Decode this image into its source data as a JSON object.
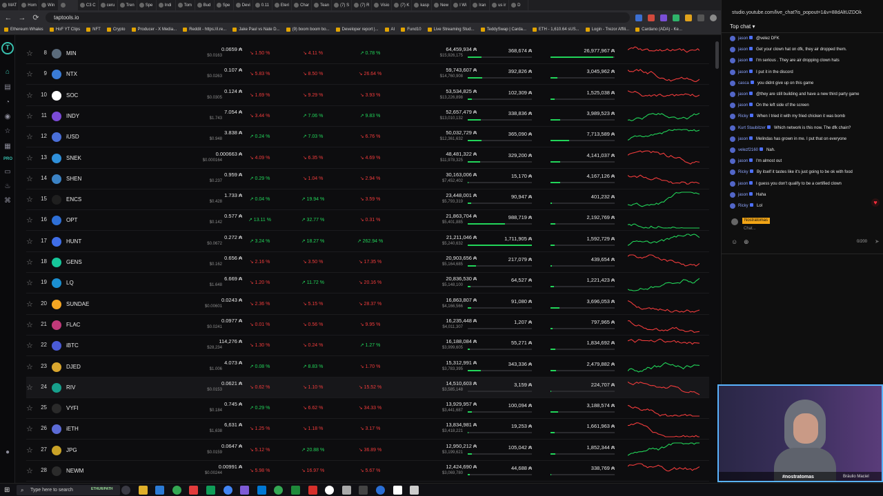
{
  "browser": {
    "tabs": [
      "MAT",
      "Hom",
      "Win",
      "",
      "C3 C",
      "ceru",
      "Tren",
      "Spe",
      "Indi",
      "Tom",
      "Bud",
      "Spe",
      "Devi",
      "0.11",
      "Eteri",
      "Char",
      "Tean",
      "(7) S",
      "(7) R",
      "Visio",
      "(7) K",
      "kasp",
      "New",
      "I Wi",
      "Iran",
      "us ir",
      "D"
    ],
    "url": "taptools.io",
    "bookmarks": [
      "Ethereum Whales",
      "HoF YT Clips",
      "NFT",
      "Crypto",
      "Producer - X Media...",
      "Reddit - https://i.re...",
      "Jake Paul vs Nate D...",
      "(9) boom boom bo...",
      "Developer report |...",
      "AI",
      "Fund10",
      "Live Streaming Stud...",
      "TeddySwap | Carda...",
      "ETH - 1,610.64 sUS...",
      "Login - Trezor Affili...",
      "Cardano (ADA) - Ke..."
    ]
  },
  "sidebar": {
    "logo": "T",
    "pro_label": "PRO"
  },
  "colors": {
    "negative": "#f23c3c",
    "positive": "#22d65a",
    "accent": "#39c2b0"
  },
  "tokens": [
    {
      "rank": "8",
      "name": "MIN",
      "price": "0.0659 ₳",
      "usd": "$0.0163",
      "c1": "↘ 1.50 %",
      "c1d": "neg",
      "c2": "↘ 4.11 %",
      "c2d": "neg",
      "c3": "↗ 0.78 %",
      "c3d": "pos",
      "mcap": "64,459,934 ₳",
      "mcapusd": "$15,926,175",
      "vol": "368,674 ₳",
      "volpct": 0.22,
      "liq": "26,977,967 ₳",
      "liqpct": 0.98,
      "spark": "neg",
      "icon": "#5a6a7a",
      "hl": false
    },
    {
      "rank": "9",
      "name": "NTX",
      "price": "0.107 ₳",
      "usd": "$0.0263",
      "c1": "↘ 5.83 %",
      "c1d": "neg",
      "c2": "↘ 8.50 %",
      "c2d": "neg",
      "c3": "↘ 26.64 %",
      "c3d": "neg",
      "mcap": "59,743,607 ₳",
      "mcapusd": "$14,760,908",
      "vol": "392,826 ₳",
      "volpct": 0.23,
      "liq": "3,045,962 ₳",
      "liqpct": 0.11,
      "spark": "neg",
      "icon": "#3a7bd5",
      "hl": false
    },
    {
      "rank": "10",
      "name": "SOC",
      "price": "0.124 ₳",
      "usd": "$0.0305",
      "c1": "↘ 1.69 %",
      "c1d": "neg",
      "c2": "↘ 9.29 %",
      "c2d": "neg",
      "c3": "↘ 3.93 %",
      "c3d": "neg",
      "mcap": "53,534,825 ₳",
      "mcapusd": "$13,226,898",
      "vol": "102,309 ₳",
      "volpct": 0.06,
      "liq": "1,525,038 ₳",
      "liqpct": 0.06,
      "spark": "neg",
      "icon": "#ffffff",
      "hl": false
    },
    {
      "rank": "11",
      "name": "INDY",
      "price": "7.054 ₳",
      "usd": "$1.743",
      "c1": "↘ 3.44 %",
      "c1d": "neg",
      "c2": "↗ 7.06 %",
      "c2d": "pos",
      "c3": "↗ 9.83 %",
      "c3d": "pos",
      "mcap": "52,657,479 ₳",
      "mcapusd": "$13,010,132",
      "vol": "338,836 ₳",
      "volpct": 0.2,
      "liq": "3,989,523 ₳",
      "liqpct": 0.15,
      "spark": "pos",
      "icon": "#7b4bd6",
      "hl": false
    },
    {
      "rank": "12",
      "name": "iUSD",
      "price": "3.838 ₳",
      "usd": "$0.948",
      "c1": "↗ 0.24 %",
      "c1d": "pos",
      "c2": "↗ 7.03 %",
      "c2d": "pos",
      "c3": "↘ 6.76 %",
      "c3d": "neg",
      "mcap": "50,032,729 ₳",
      "mcapusd": "$12,361,632",
      "vol": "365,090 ₳",
      "volpct": 0.21,
      "liq": "7,713,589 ₳",
      "liqpct": 0.29,
      "spark": "pos",
      "icon": "#4a6fd8",
      "hl": false
    },
    {
      "rank": "13",
      "name": "SNEK",
      "price": "0.000663 ₳",
      "usd": "$0.000164",
      "c1": "↘ 4.09 %",
      "c1d": "neg",
      "c2": "↘ 6.35 %",
      "c2d": "neg",
      "c3": "↘ 4.69 %",
      "c3d": "neg",
      "mcap": "48,481,322 ₳",
      "mcapusd": "$11,978,325",
      "vol": "329,200 ₳",
      "volpct": 0.19,
      "liq": "4,141,037 ₳",
      "liqpct": 0.15,
      "spark": "neg",
      "icon": "#2f8fd9",
      "hl": false
    },
    {
      "rank": "14",
      "name": "SHEN",
      "price": "0.959 ₳",
      "usd": "$0.237",
      "c1": "↗ 0.29 %",
      "c1d": "pos",
      "c2": "↘ 1.04 %",
      "c2d": "neg",
      "c3": "↘ 2.94 %",
      "c3d": "neg",
      "mcap": "30,163,006 ₳",
      "mcapusd": "$7,452,402",
      "vol": "15,170 ₳",
      "volpct": 0.01,
      "liq": "4,167,126 ₳",
      "liqpct": 0.15,
      "spark": "neg",
      "icon": "#3b82c4",
      "hl": false
    },
    {
      "rank": "15",
      "name": "ENCS",
      "price": "1.733 ₳",
      "usd": "$0.428",
      "c1": "↗ 0.04 %",
      "c1d": "pos",
      "c2": "↗ 19.94 %",
      "c2d": "pos",
      "c3": "↘ 3.59 %",
      "c3d": "neg",
      "mcap": "23,448,001 ₳",
      "mcapusd": "$5,793,319",
      "vol": "90,947 ₳",
      "volpct": 0.05,
      "liq": "401,232 ₳",
      "liqpct": 0.02,
      "spark": "pos",
      "icon": "#1f1f1f",
      "hl": false
    },
    {
      "rank": "16",
      "name": "OPT",
      "price": "0.577 ₳",
      "usd": "$0.142",
      "c1": "↗ 13.11 %",
      "c1d": "pos",
      "c2": "↗ 32.77 %",
      "c2d": "pos",
      "c3": "↘ 0.31 %",
      "c3d": "neg",
      "mcap": "21,863,704 ₳",
      "mcapusd": "$5,401,885",
      "vol": "988,719 ₳",
      "volpct": 0.58,
      "liq": "2,192,769 ₳",
      "liqpct": 0.08,
      "spark": "pos",
      "icon": "#2e6fd6",
      "hl": false
    },
    {
      "rank": "17",
      "name": "HUNT",
      "price": "0.272 ₳",
      "usd": "$0.0672",
      "c1": "↗ 3.24 %",
      "c1d": "pos",
      "c2": "↗ 18.27 %",
      "c2d": "pos",
      "c3": "↗ 262.94 %",
      "c3d": "pos",
      "mcap": "21,211,046 ₳",
      "mcapusd": "$5,240,632",
      "vol": "1,711,905 ₳",
      "volpct": 1.0,
      "liq": "1,592,729 ₳",
      "liqpct": 0.06,
      "spark": "pos",
      "icon": "#3f6ee8",
      "hl": false
    },
    {
      "rank": "18",
      "name": "GENS",
      "price": "0.656 ₳",
      "usd": "$0.162",
      "c1": "↘ 2.16 %",
      "c1d": "neg",
      "c2": "↘ 3.50 %",
      "c2d": "neg",
      "c3": "↘ 17.35 %",
      "c3d": "neg",
      "mcap": "20,903,656 ₳",
      "mcapusd": "$5,164,685",
      "vol": "217,079 ₳",
      "volpct": 0.13,
      "liq": "439,654 ₳",
      "liqpct": 0.02,
      "spark": "neg",
      "icon": "#16c79a",
      "hl": false
    },
    {
      "rank": "19",
      "name": "LQ",
      "price": "6.669 ₳",
      "usd": "$1.648",
      "c1": "↘ 1.20 %",
      "c1d": "neg",
      "c2": "↗ 11.72 %",
      "c2d": "pos",
      "c3": "↘ 20.16 %",
      "c3d": "neg",
      "mcap": "20,836,530 ₳",
      "mcapusd": "$5,148,100",
      "vol": "64,527 ₳",
      "volpct": 0.04,
      "liq": "1,221,423 ₳",
      "liqpct": 0.05,
      "spark": "pos",
      "icon": "#1b8fd1",
      "hl": false
    },
    {
      "rank": "20",
      "name": "SUNDAE",
      "price": "0.0243 ₳",
      "usd": "$0.00601",
      "c1": "↘ 2.36 %",
      "c1d": "neg",
      "c2": "↘ 5.15 %",
      "c2d": "neg",
      "c3": "↘ 28.37 %",
      "c3d": "neg",
      "mcap": "16,863,807 ₳",
      "mcapusd": "$4,166,566",
      "vol": "91,080 ₳",
      "volpct": 0.05,
      "liq": "3,696,053 ₳",
      "liqpct": 0.14,
      "spark": "neg",
      "icon": "#f5a623",
      "hl": false
    },
    {
      "rank": "21",
      "name": "FLAC",
      "price": "0.0977 ₳",
      "usd": "$0.0241",
      "c1": "↘ 0.01 %",
      "c1d": "neg",
      "c2": "↘ 0.56 %",
      "c2d": "neg",
      "c3": "↘ 9.95 %",
      "c3d": "neg",
      "mcap": "16,235,448 ₳",
      "mcapusd": "$4,011,307",
      "vol": "1,207 ₳",
      "volpct": 0.0,
      "liq": "797,965 ₳",
      "liqpct": 0.03,
      "spark": "neg",
      "icon": "#c0397a",
      "hl": false
    },
    {
      "rank": "22",
      "name": "iBTC",
      "price": "114,276 ₳",
      "usd": "$28,234",
      "c1": "↘ 1.30 %",
      "c1d": "neg",
      "c2": "↘ 0.24 %",
      "c2d": "neg",
      "c3": "↗ 1.27 %",
      "c3d": "pos",
      "mcap": "16,188,084 ₳",
      "mcapusd": "$3,999,605",
      "vol": "55,271 ₳",
      "volpct": 0.03,
      "liq": "1,834,692 ₳",
      "liqpct": 0.07,
      "spark": "neg",
      "icon": "#4a5bd6",
      "hl": false
    },
    {
      "rank": "23",
      "name": "DJED",
      "price": "4.073 ₳",
      "usd": "$1.006",
      "c1": "↗ 0.08 %",
      "c1d": "pos",
      "c2": "↗ 8.83 %",
      "c2d": "pos",
      "c3": "↘ 1.70 %",
      "c3d": "neg",
      "mcap": "15,312,991 ₳",
      "mcapusd": "$3,783,395",
      "vol": "343,336 ₳",
      "volpct": 0.2,
      "liq": "2,479,882 ₳",
      "liqpct": 0.09,
      "spark": "pos",
      "icon": "#d9a62e",
      "hl": false
    },
    {
      "rank": "24",
      "name": "RIV",
      "price": "0.0621 ₳",
      "usd": "$0.0153",
      "c1": "↘ 0.62 %",
      "c1d": "neg",
      "c2": "↘ 1.10 %",
      "c2d": "neg",
      "c3": "↘ 15.52 %",
      "c3d": "neg",
      "mcap": "14,510,603 ₳",
      "mcapusd": "$3,585,148",
      "vol": "3,159 ₳",
      "volpct": 0.0,
      "liq": "224,707 ₳",
      "liqpct": 0.01,
      "spark": "neg",
      "icon": "#17a08c",
      "hl": true
    },
    {
      "rank": "25",
      "name": "VYFI",
      "price": "0.745 ₳",
      "usd": "$0.184",
      "c1": "↗ 0.29 %",
      "c1d": "pos",
      "c2": "↘ 6.62 %",
      "c2d": "neg",
      "c3": "↘ 34.33 %",
      "c3d": "neg",
      "mcap": "13,929,957 ₳",
      "mcapusd": "$3,441,687",
      "vol": "100,094 ₳",
      "volpct": 0.06,
      "liq": "3,188,574 ₳",
      "liqpct": 0.12,
      "spark": "neg",
      "icon": "#2a2a2a",
      "hl": false
    },
    {
      "rank": "26",
      "name": "iETH",
      "price": "6,631 ₳",
      "usd": "$1,638",
      "c1": "↘ 1.25 %",
      "c1d": "neg",
      "c2": "↘ 1.18 %",
      "c2d": "neg",
      "c3": "↘ 3.17 %",
      "c3d": "neg",
      "mcap": "13,834,981 ₳",
      "mcapusd": "$3,418,221",
      "vol": "19,253 ₳",
      "volpct": 0.01,
      "liq": "1,661,963 ₳",
      "liqpct": 0.06,
      "spark": "neg",
      "icon": "#5c6bd6",
      "hl": false
    },
    {
      "rank": "27",
      "name": "JPG",
      "price": "0.0647 ₳",
      "usd": "$0.0159",
      "c1": "↘ 5.12 %",
      "c1d": "neg",
      "c2": "↗ 20.88 %",
      "c2d": "pos",
      "c3": "↘ 36.89 %",
      "c3d": "neg",
      "mcap": "12,950,212 ₳",
      "mcapusd": "$3,199,621",
      "vol": "105,042 ₳",
      "volpct": 0.06,
      "liq": "1,852,344 ₳",
      "liqpct": 0.07,
      "spark": "pos",
      "icon": "#c9a227",
      "hl": false
    },
    {
      "rank": "28",
      "name": "NEWM",
      "price": "0.00991 ₳",
      "usd": "$0.00244",
      "c1": "↘ 5.98 %",
      "c1d": "neg",
      "c2": "↘ 16.97 %",
      "c2d": "neg",
      "c3": "↘ 5.67 %",
      "c3d": "neg",
      "mcap": "12,424,690 ₳",
      "mcapusd": "$3,069,780",
      "vol": "44,688 ₳",
      "volpct": 0.03,
      "liq": "338,769 ₳",
      "liqpct": 0.01,
      "spark": "neg",
      "icon": "#2b2b2b",
      "hl": false
    }
  ],
  "chat": {
    "url": "studio.youtube.com/live_chat?is_popout=1&v=88dAltUZDOk",
    "header": "Top chat",
    "messages": [
      {
        "author": "jason",
        "text": "@velez DFK"
      },
      {
        "author": "jason",
        "text": "Get your clown hat on dfk, they air dropped them."
      },
      {
        "author": "jason",
        "text": "I'm serious . They are air dropping clown hats"
      },
      {
        "author": "jason",
        "text": "I put it in the discord"
      },
      {
        "author": "casca",
        "text": "you didnt give up on this game"
      },
      {
        "author": "jason",
        "text": "@they are still building and have a new third party game"
      },
      {
        "author": "jason",
        "text": "On the left side of the screen"
      },
      {
        "author": "Ricky",
        "text": "When I tried it with my fried chicken it was bomb"
      },
      {
        "author": "Kurt Staubitzer",
        "text": "Which network is this now. The dfk chain?"
      },
      {
        "author": "jason",
        "text": "Melindas has grown in me. I put that on everyone"
      },
      {
        "author": "velezf2160",
        "text": "Nah."
      },
      {
        "author": "jason",
        "text": "I'm almost out"
      },
      {
        "author": "Ricky",
        "text": "By itself it tastes like it's just going to be ok with food"
      },
      {
        "author": "jason",
        "text": "I guess you don't qualify to be a certified clown"
      },
      {
        "author": "jason",
        "text": "Haha"
      },
      {
        "author": "Ricky",
        "text": "Lol"
      }
    ],
    "sender_name": "Nostratomas",
    "placeholder": "Chat...",
    "counter": "0/200"
  },
  "webcam": {
    "name": "#nostratomas",
    "caption": "Bráulio Maciel"
  },
  "taskbar": {
    "search_placeholder": "Type here to search",
    "app_label": "ETHUR/PATH"
  }
}
